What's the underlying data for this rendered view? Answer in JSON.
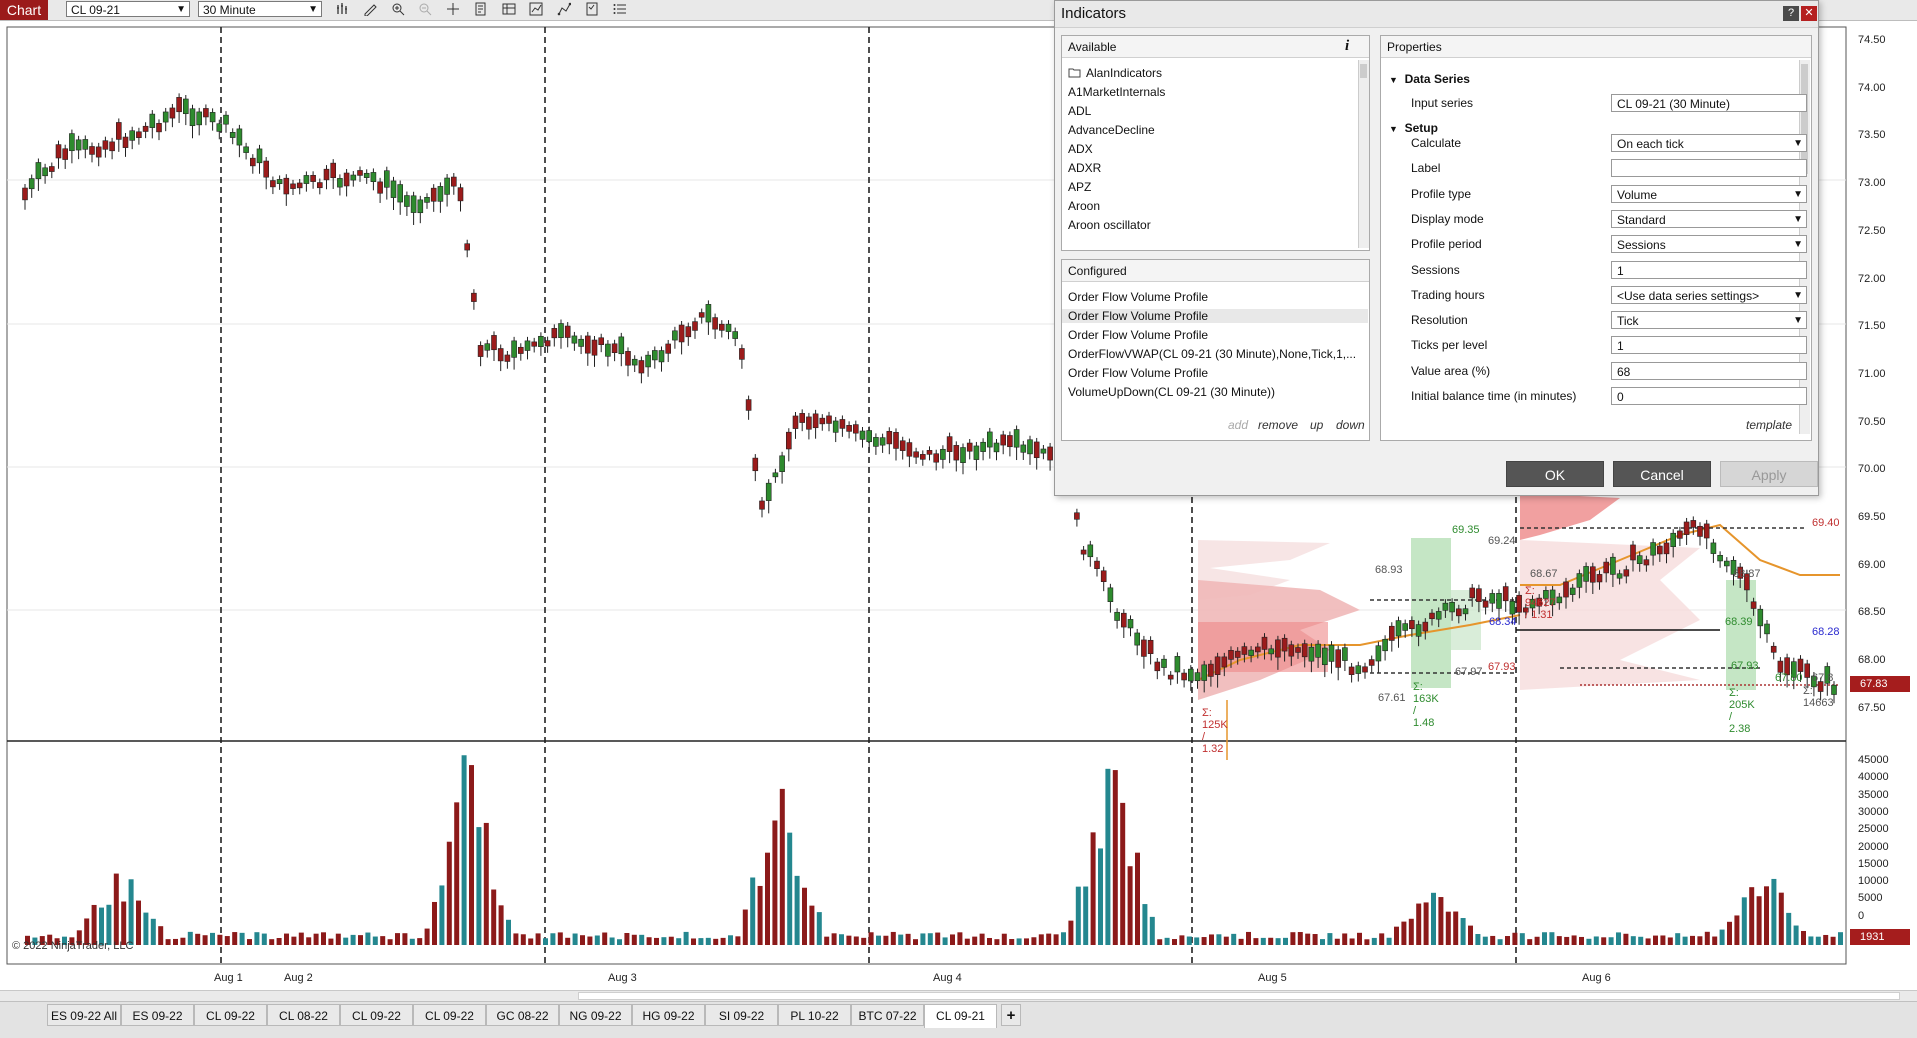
{
  "toolbar": {
    "chart_tab": "Chart",
    "instrument": "CL 09-21",
    "interval": "30 Minute"
  },
  "price_axis": [
    "74.50",
    "74.00",
    "73.50",
    "73.00",
    "72.50",
    "72.00",
    "71.50",
    "71.00",
    "70.50",
    "70.00",
    "69.50",
    "69.00",
    "68.50",
    "68.00",
    "67.50"
  ],
  "volume_axis": [
    "45000",
    "40000",
    "35000",
    "30000",
    "25000",
    "20000",
    "15000",
    "10000",
    "5000",
    "0"
  ],
  "current_price": "67.83",
  "current_volume": "1931",
  "date_labels": [
    "Aug 1",
    "Aug 2",
    "Aug 3",
    "Aug 4",
    "Aug 5",
    "Aug 6"
  ],
  "copyright": "© 2022 NinjaTrader, LLC",
  "profile_labels": {
    "p1_vah": "68.93",
    "p1_val": "67.61",
    "p1_sum": "Σ: 125K / 1.32",
    "p2_high": "69.35",
    "p2_a": "69.24",
    "p2_val": "67.97",
    "p2_sum": "Σ: 163K / 1.48",
    "p2_poc": "68.34",
    "p2_b": "67.93",
    "p3_sum": "Σ: 94627 / 1.31",
    "p3_a": "68.87",
    "p3_b": "68.67",
    "p4_vah": "69.40",
    "p4_poc": "68.39",
    "p4_val": "67.93",
    "p4_low": "67.80",
    "p4_sum": "Σ: 205K / 2.38",
    "p4_r1": "68.28",
    "p4_r2": "67.8",
    "p4_sum2": "Σ: 14663"
  },
  "bottom_tabs": [
    "ES 09-22 All",
    "ES 09-22",
    "CL 09-22",
    "CL 08-22",
    "CL 09-22",
    "CL 09-22",
    "GC 08-22",
    "NG 09-22",
    "HG 09-22",
    "SI 09-22",
    "PL 10-22",
    "BTC 07-22",
    "CL 09-21"
  ],
  "add_tab": "+",
  "dialog": {
    "title": "Indicators",
    "available_header": "Available",
    "available_items": [
      "AlanIndicators",
      "A1MarketInternals",
      "ADL",
      "AdvanceDecline",
      "ADX",
      "ADXR",
      "APZ",
      "Aroon",
      "Aroon oscillator"
    ],
    "configured_header": "Configured",
    "configured_items": [
      "Order Flow Volume Profile",
      "Order Flow Volume Profile",
      "Order Flow Volume Profile",
      "OrderFlowVWAP(CL 09-21 (30 Minute),None,Tick,1,...",
      "Order Flow Volume Profile",
      "VolumeUpDown(CL 09-21 (30 Minute))"
    ],
    "configured_actions": {
      "add": "add",
      "remove": "remove",
      "up": "up",
      "down": "down"
    },
    "properties_header": "Properties",
    "groups": {
      "data_series": "Data Series",
      "setup": "Setup"
    },
    "properties": [
      {
        "label": "Input series",
        "value": "CL 09-21 (30 Minute)"
      },
      {
        "label": "Calculate",
        "value": "On each tick"
      },
      {
        "label": "Label",
        "value": ""
      },
      {
        "label": "Profile type",
        "value": "Volume"
      },
      {
        "label": "Display mode",
        "value": "Standard"
      },
      {
        "label": "Profile period",
        "value": "Sessions"
      },
      {
        "label": "Sessions",
        "value": "1"
      },
      {
        "label": "Trading hours",
        "value": "<Use data series settings>"
      },
      {
        "label": "Resolution",
        "value": "Tick"
      },
      {
        "label": "Ticks per level",
        "value": "1"
      },
      {
        "label": "Value area (%)",
        "value": "68"
      },
      {
        "label": "Initial balance time (in minutes)",
        "value": "0"
      }
    ],
    "template_link": "template",
    "ok": "OK",
    "cancel": "Cancel",
    "apply": "Apply",
    "info_icon_text": "i"
  }
}
